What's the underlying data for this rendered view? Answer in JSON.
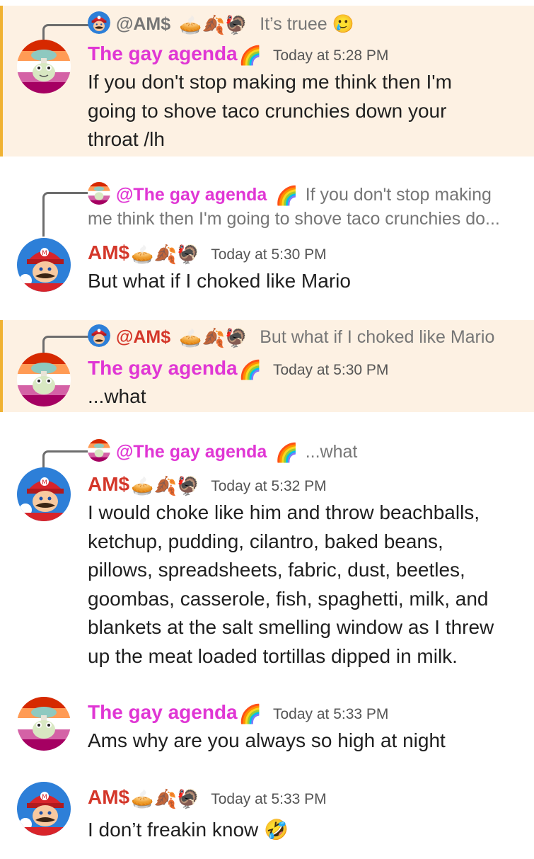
{
  "messages": [
    {
      "reply": {
        "name": "@AM$",
        "emoji": "🥧🍂🦃",
        "preview": "It’s truee 🥲"
      },
      "author": "The gay agenda",
      "author_emoji": "🌈",
      "timestamp": "Today at 5:28 PM",
      "lines": [
        "If you don't stop making me think then I'm",
        "going to shove taco crunchies down your",
        "throat /lh"
      ]
    },
    {
      "reply": {
        "name": "@The gay agenda",
        "emoji": "🌈",
        "preview": "If you don't stop making",
        "preview2": "me think then I'm going to shove taco crunchies do..."
      },
      "author": "AM$",
      "author_emoji": "🥧🍂🦃",
      "timestamp": "Today at 5:30 PM",
      "lines": [
        "But what if I choked like Mario"
      ]
    },
    {
      "reply": {
        "name": "@AM$",
        "emoji": "🥧🍂🦃",
        "preview": "But what if I choked like Mario"
      },
      "author": "The gay agenda",
      "author_emoji": "🌈",
      "timestamp": "Today at 5:30 PM",
      "lines": [
        "...what"
      ]
    },
    {
      "reply": {
        "name": "@The gay agenda",
        "emoji": "🌈",
        "preview": "...what"
      },
      "author": "AM$",
      "author_emoji": "🥧🍂🦃",
      "timestamp": "Today at 5:32 PM",
      "lines": [
        "I would choke like him and throw beachballs,",
        "ketchup, pudding, cilantro, baked beans,",
        "pillows, spreadsheets, fabric, dust, beetles,",
        "goombas, casserole, fish, spaghetti, milk, and",
        "blankets at the salt smelling window as I threw",
        "up the meat loaded tortillas dipped in milk."
      ]
    },
    {
      "author": "The gay agenda",
      "author_emoji": "🌈",
      "timestamp": "Today at 5:33 PM",
      "lines": [
        "Ams why are you always so high at night"
      ]
    },
    {
      "author": "AM$",
      "author_emoji": "🥧🍂🦃",
      "timestamp": "Today at 5:33 PM",
      "lines": [
        "I don’t freakin know 🤣"
      ]
    }
  ],
  "colors": {
    "highlight_bg": "#fdf1e3",
    "highlight_bar": "#f0b232",
    "gay_agenda_name": "#e036d4",
    "ams_name": "#d4372a",
    "timestamp": "#555555",
    "reply_preview": "#767676"
  },
  "icons": {
    "gay_agenda_avatar": "frog-mushroom-lesbian-flag-avatar",
    "ams_avatar": "mario-avatar"
  }
}
